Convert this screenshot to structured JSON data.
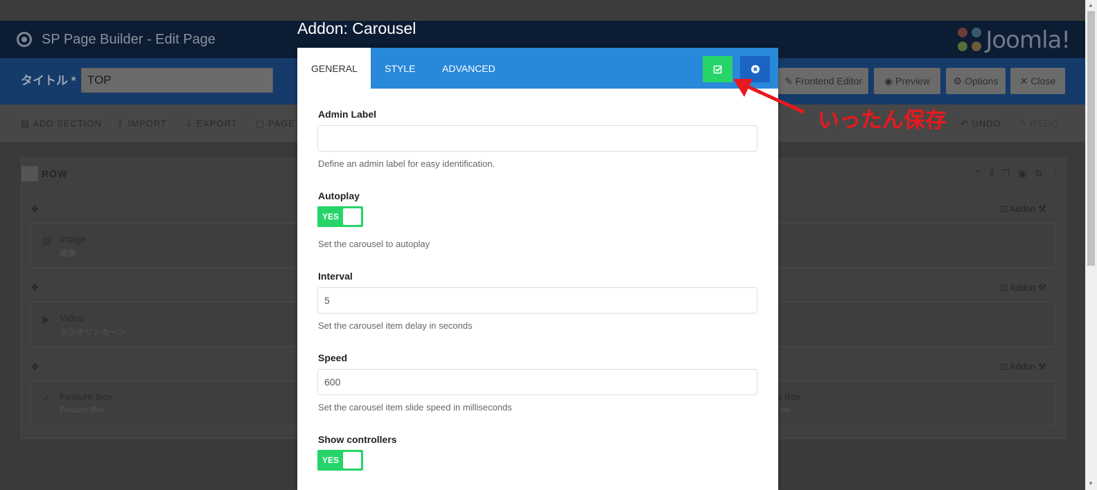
{
  "app": {
    "title": "SP Page Builder - Edit Page",
    "brand": "Joomla!"
  },
  "title_bar": {
    "label": "タイトル *",
    "value": "TOP",
    "buttons": {
      "frontend_editor": "Frontend Editor",
      "preview": "Preview",
      "options": "Options",
      "close": "Close"
    }
  },
  "toolbar": {
    "add_section": "ADD SECTION",
    "import": "IMPORT",
    "export": "EXPORT",
    "page_templates": "PAGE T",
    "undo": "UNDO",
    "redo": "REDO"
  },
  "row": {
    "label": "ROW",
    "addon_link": "Addon",
    "addons": [
      {
        "name": "Image",
        "sub": "画像",
        "right_name": "",
        "right_sub": ""
      },
      {
        "name": "Video",
        "sub": "ラジオリンカーン",
        "right_name": "",
        "right_sub": ""
      },
      {
        "name": "Feature Box",
        "sub": "Feature Box",
        "right_name": "e Box",
        "right_sub": "ox"
      }
    ]
  },
  "modal": {
    "title": "Addon: Carousel",
    "tabs": [
      "GENERAL",
      "STYLE",
      "ADVANCED"
    ],
    "active_tab": "GENERAL",
    "fields": {
      "admin_label": {
        "label": "Admin Label",
        "value": "",
        "help": "Define an admin label for easy identification."
      },
      "autoplay": {
        "label": "Autoplay",
        "value": "YES",
        "help": "Set the carousel to autoplay"
      },
      "interval": {
        "label": "Interval",
        "value": "5",
        "help": "Set the carousel item delay in seconds"
      },
      "speed": {
        "label": "Speed",
        "value": "600",
        "help": "Set the carousel item slide speed in milliseconds"
      },
      "show_controllers": {
        "label": "Show controllers",
        "value": "YES"
      }
    },
    "icons": {
      "save": "save-check-icon",
      "close": "close-circle-icon"
    }
  },
  "annotation": {
    "text": "いったん保存"
  },
  "colors": {
    "tab_bar": "#2888d9",
    "save_green": "#27d46a",
    "close_blue": "#1b64c4",
    "annotation_red": "#e8191e"
  }
}
